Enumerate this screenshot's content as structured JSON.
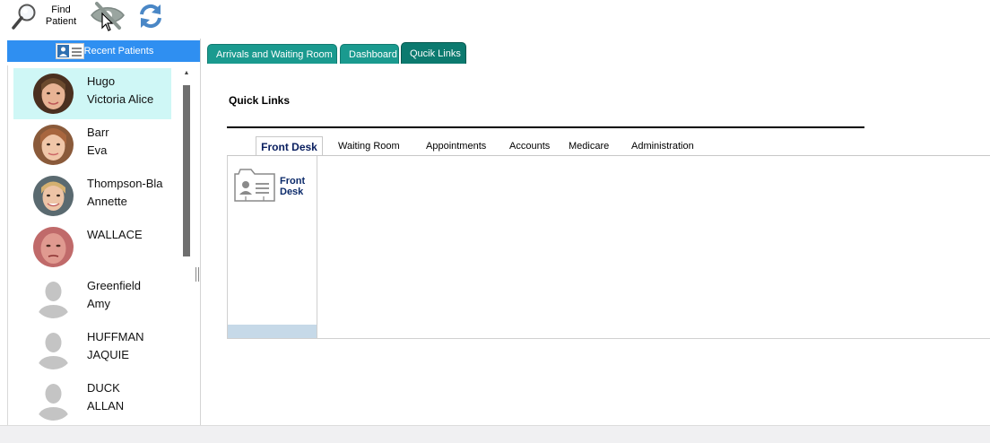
{
  "toolbar": {
    "find_label": "Find Patient",
    "find_icon": "magnifier-icon",
    "hide_icon": "eye-slash-icon",
    "refresh_icon": "refresh-icon"
  },
  "recent_patients": {
    "title": "Recent Patients",
    "patients": [
      {
        "line1": "Hugo",
        "line2": "Victoria Alice",
        "photo": "photo",
        "selected": true
      },
      {
        "line1": "Barr",
        "line2": "Eva",
        "photo": "photo"
      },
      {
        "line1": "Thompson-Bla",
        "line2": "Annette",
        "photo": "photo"
      },
      {
        "line1": "WALLACE",
        "line2": "",
        "photo": "photo"
      },
      {
        "line1": "Greenfield",
        "line2": "Amy",
        "photo": "placeholder"
      },
      {
        "line1": "HUFFMAN",
        "line2": "JAQUIE",
        "photo": "placeholder"
      },
      {
        "line1": "DUCK",
        "line2": "ALLAN",
        "photo": "placeholder"
      }
    ]
  },
  "tabs": [
    {
      "label": "Arrivals and Waiting Room",
      "active": false
    },
    {
      "label": "Dashboard",
      "active": false
    },
    {
      "label": "Qucik Links",
      "active": true
    }
  ],
  "quick_links": {
    "title": "Quick Links",
    "subtabs": [
      {
        "label": "Front Desk",
        "active": true
      },
      {
        "label": "Waiting Room"
      },
      {
        "label": "Appointments"
      },
      {
        "label": "Accounts"
      },
      {
        "label": "Medicare"
      },
      {
        "label": "Administration"
      }
    ],
    "tiles": [
      {
        "label": "Front Desk",
        "icon": "contact-card-icon"
      }
    ]
  },
  "colors": {
    "header_blue": "#2f8ff1",
    "tab_teal": "#1a9a8f",
    "tab_teal_active": "#0c7a6f",
    "selected_row": "#cff7f6",
    "link_navy": "#0b2a6a"
  }
}
